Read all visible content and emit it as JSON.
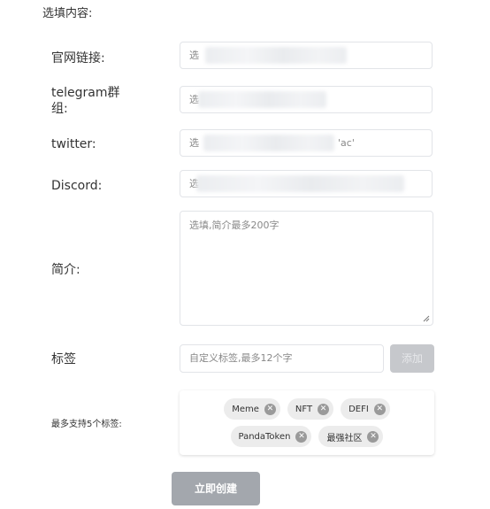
{
  "section_title": "选填内容:",
  "fields": {
    "website": {
      "label": "官网链接:",
      "value_prefix": "选"
    },
    "telegram": {
      "label_line1": "telegram群",
      "label_line2": "组:",
      "value_prefix": "选"
    },
    "twitter": {
      "label": "twitter:",
      "value_prefix": "选",
      "value_suffix": "'ac'"
    },
    "discord": {
      "label": "Discord:",
      "value_prefix": "选"
    },
    "intro": {
      "label": "简介:",
      "placeholder": "选填,简介最多200字"
    },
    "tag": {
      "label": "标签",
      "placeholder": "自定义标签,最多12个字",
      "add_label": "添加"
    }
  },
  "tags_hint": "最多支持5个标签:",
  "tags": [
    {
      "text": "Meme"
    },
    {
      "text": "NFT"
    },
    {
      "text": "DEFI"
    },
    {
      "text": "PandaToken"
    },
    {
      "text": "最强社区"
    }
  ],
  "create_button": "立即创建",
  "colors": {
    "disabled_button": "#a3a7ad",
    "tag_bg": "#ececec"
  }
}
